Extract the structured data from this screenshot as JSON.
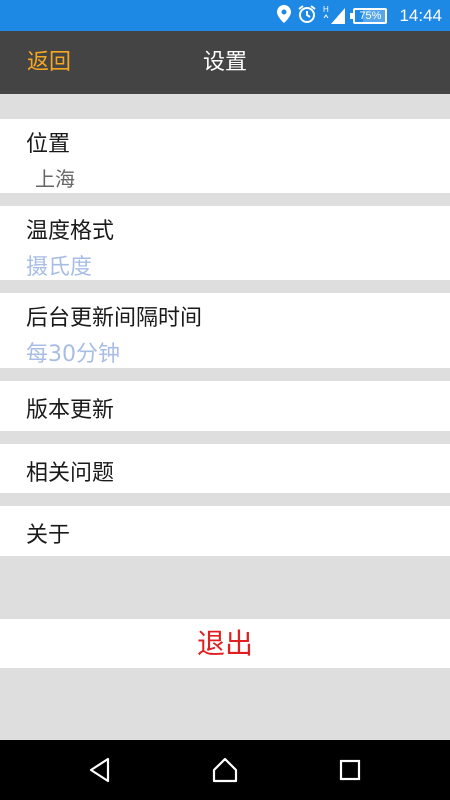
{
  "status_bar": {
    "time": "14:44",
    "battery": "75%",
    "battery_level": 0.75,
    "icons": [
      "location-icon",
      "alarm-icon",
      "signal-icon",
      "battery-icon"
    ]
  },
  "header": {
    "back_label": "返回",
    "title": "设置"
  },
  "settings": [
    {
      "label": "位置",
      "value": "上海"
    },
    {
      "label": "温度格式",
      "value": "摄氏度"
    },
    {
      "label": "后台更新间隔时间",
      "value": "每30分钟"
    },
    {
      "label": "版本更新"
    },
    {
      "label": "相关问题"
    },
    {
      "label": "关于"
    }
  ],
  "logout_label": "退出",
  "nav": [
    "back-icon",
    "home-icon",
    "recents-icon"
  ],
  "colors": {
    "status_bar": "#1e88e5",
    "app_bar": "#444444",
    "back_accent": "#f5a623",
    "value_blue": "#a8bde6",
    "logout_red": "#e02020",
    "background": "#dedede"
  }
}
